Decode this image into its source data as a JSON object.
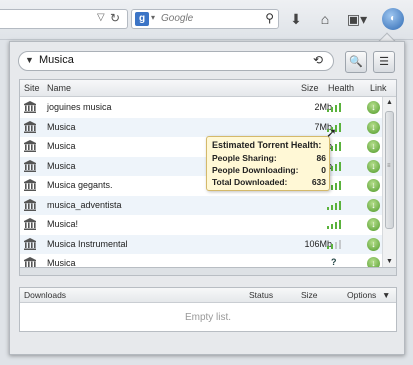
{
  "toolbar": {
    "search_engine_letter": "g",
    "search_placeholder": "Google"
  },
  "panel": {
    "query": "Musica"
  },
  "results": {
    "columns": {
      "site": "Site",
      "name": "Name",
      "size": "Size",
      "health": "Health",
      "link": "Link"
    },
    "rows": [
      {
        "name": "joguines musica",
        "size": "2Mb",
        "health": 4
      },
      {
        "name": "Musica",
        "size": "7Mb",
        "health": 4
      },
      {
        "name": "Musica",
        "size": "6Mb",
        "health": 4
      },
      {
        "name": "Musica",
        "size": "7Mb",
        "health": 4
      },
      {
        "name": "Musica gegants.",
        "size": "",
        "health": 4
      },
      {
        "name": "musica_adventista",
        "size": "",
        "health": 4
      },
      {
        "name": "Musica!",
        "size": "",
        "health": 4
      },
      {
        "name": "Musica Instrumental",
        "size": "106Mb",
        "health": 2
      },
      {
        "name": "Musica",
        "size": "",
        "health": null
      }
    ],
    "health_unknown_symbol": "?"
  },
  "tooltip": {
    "title": "Estimated Torrent Health:",
    "rows": [
      {
        "label": "People Sharing:",
        "value": "86"
      },
      {
        "label": "People Downloading:",
        "value": "0"
      },
      {
        "label": "Total Downloaded:",
        "value": "633"
      }
    ]
  },
  "downloads": {
    "columns": {
      "title": "Downloads",
      "status": "Status",
      "size": "Size",
      "options": "Options"
    },
    "empty_text": "Empty list."
  },
  "colors": {
    "health_on": "#5ab23c",
    "health_off": "#c6c9cc",
    "tooltip_bg": "#fff8d6",
    "row_alt": "#eef4fa"
  }
}
